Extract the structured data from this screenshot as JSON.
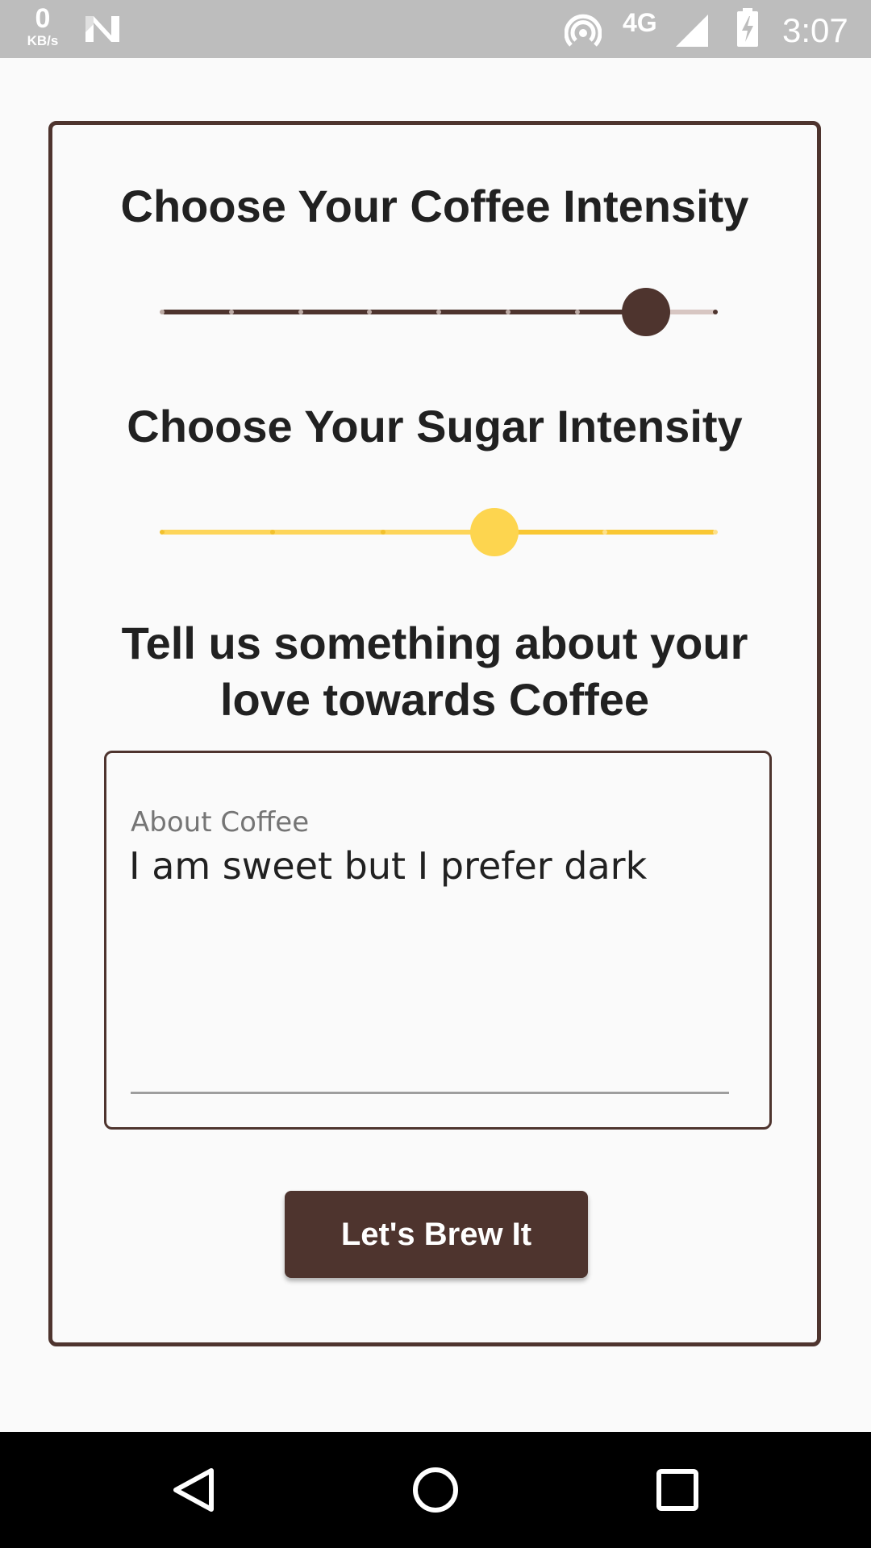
{
  "status_bar": {
    "speed_value": "0",
    "speed_unit": "KB/s",
    "network_type": "4G",
    "time": "3:07",
    "icons": [
      "notification-n-icon",
      "hotspot-icon",
      "signal-icon",
      "battery-charging-icon"
    ]
  },
  "coffee": {
    "title": "Choose Your Coffee Intensity",
    "slider_value": 7,
    "slider_max": 8,
    "color": "#4e342e"
  },
  "sugar": {
    "title": "Choose Your Sugar Intensity",
    "slider_value": 3,
    "slider_max": 5,
    "color": "#fdd54f"
  },
  "about": {
    "title": "Tell us something about your love towards Coffee",
    "label": "About Coffee",
    "value": "I am sweet but I prefer dark"
  },
  "button": {
    "label": "Let's Brew It"
  },
  "nav": {
    "icons": [
      "back-icon",
      "home-icon",
      "recents-icon"
    ]
  }
}
